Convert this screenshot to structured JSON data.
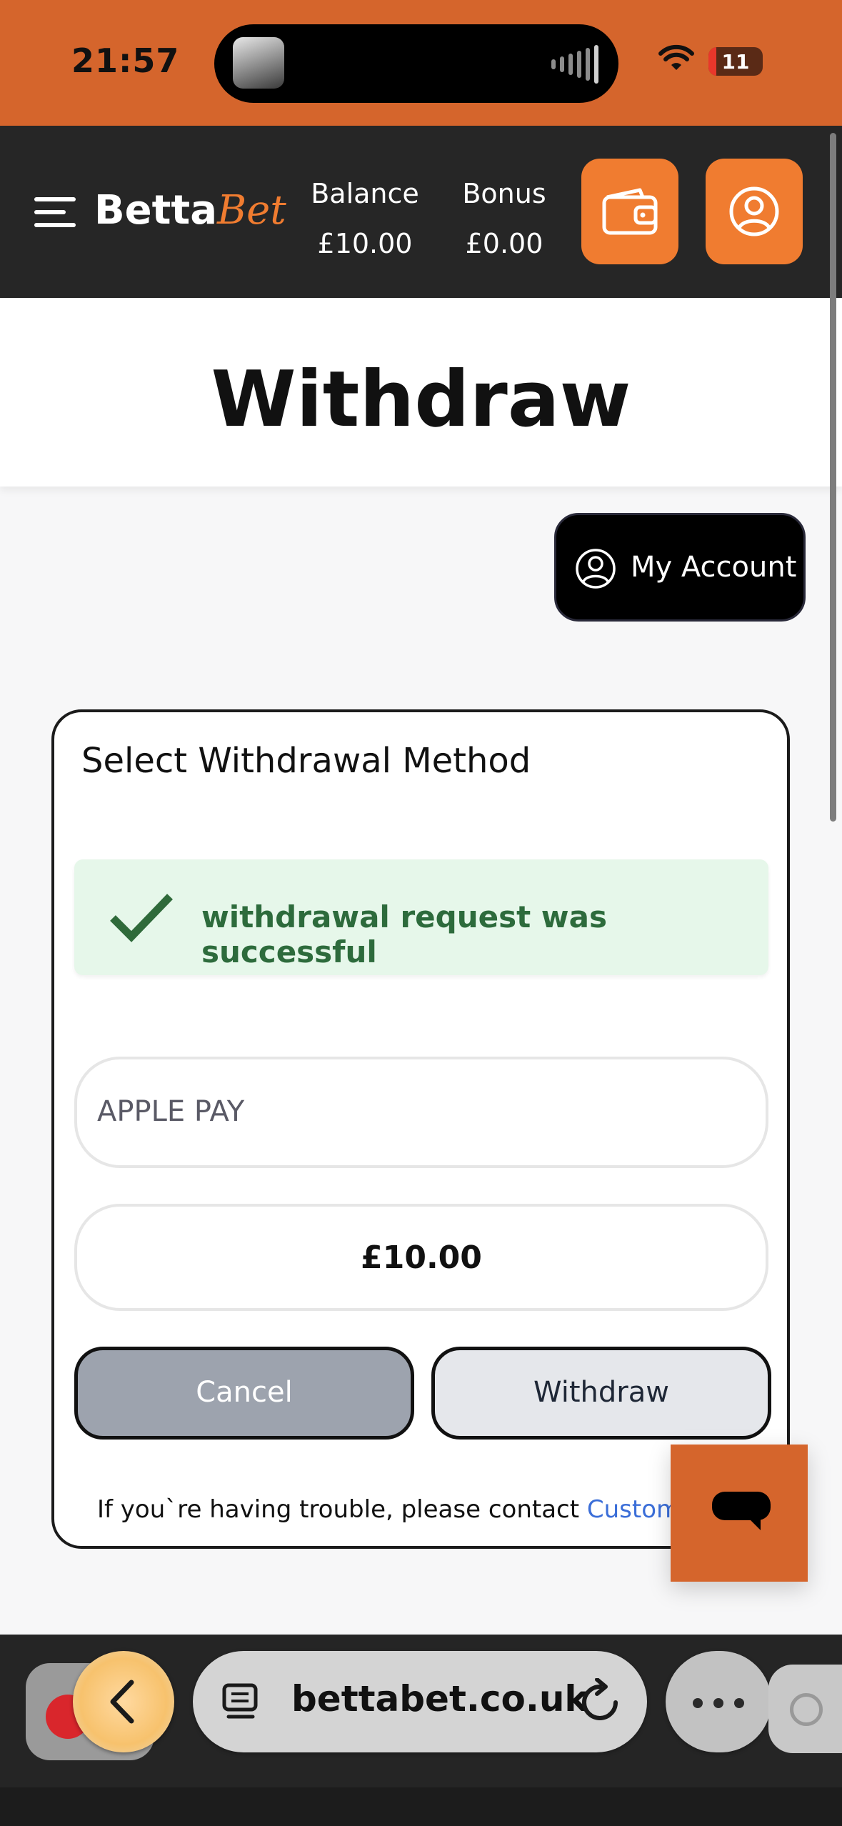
{
  "status_bar": {
    "time": "21:57",
    "battery": "11",
    "battery_level": 0.11
  },
  "header": {
    "logo_part1": "Betta",
    "logo_part2": "Bet",
    "balance_label": "Balance",
    "balance_value": "£10.00",
    "bonus_label": "Bonus",
    "bonus_value": "£0.00",
    "accent_color": "#f07c30"
  },
  "page": {
    "title": "Withdraw",
    "my_account_label": "My Account"
  },
  "withdraw_card": {
    "title": "Select Withdrawal Method",
    "success_message": "withdrawal request was successful",
    "method_value": "APPLE PAY",
    "amount_value": "£10.00",
    "cancel_label": "Cancel",
    "withdraw_label": "Withdraw",
    "help_text": "If you`re having trouble, please contact ",
    "help_link": "Customer S"
  },
  "browser": {
    "url": "bettabet.co.uk"
  },
  "icons": {
    "menu": "hamburger-icon",
    "wallet": "wallet-icon",
    "profile": "user-circle-icon",
    "success": "checkmark-icon",
    "chat": "chat-bubble-icon",
    "back": "chevron-left-icon",
    "tabs": "tabs-icon",
    "reload": "reload-icon",
    "more": "more-dots-icon"
  }
}
